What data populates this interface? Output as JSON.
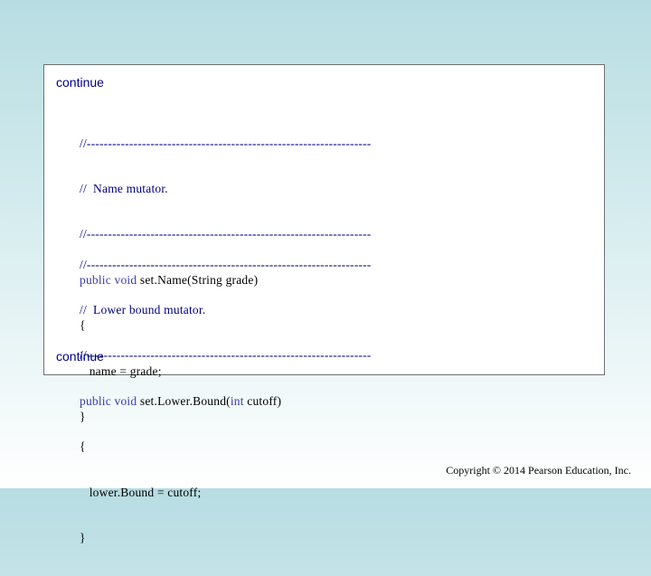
{
  "slide": {
    "continue_top": "continue",
    "continue_bottom": "continue",
    "copyright": "Copyright © 2014 Pearson Education, Inc."
  },
  "code": {
    "block1": {
      "rule_top": "//-------------------------------------------------------------------",
      "comment": "//  Name mutator.",
      "rule_bottom": "//-------------------------------------------------------------------",
      "sig_kw": "public void ",
      "sig_rest": "set.Name(String grade)",
      "open_brace": "{",
      "body": "   name = grade;",
      "close_brace": "}"
    },
    "block2": {
      "rule_top": "//-------------------------------------------------------------------",
      "comment": "//  Lower bound mutator.",
      "rule_bottom": "//-------------------------------------------------------------------",
      "sig_kw": "public void ",
      "sig_mid": "set.Lower.Bound(",
      "sig_kw2": "int",
      "sig_end": " cutoff)",
      "open_brace": "{",
      "body": "   lower.Bound = cutoff;",
      "close_brace": "}"
    }
  }
}
